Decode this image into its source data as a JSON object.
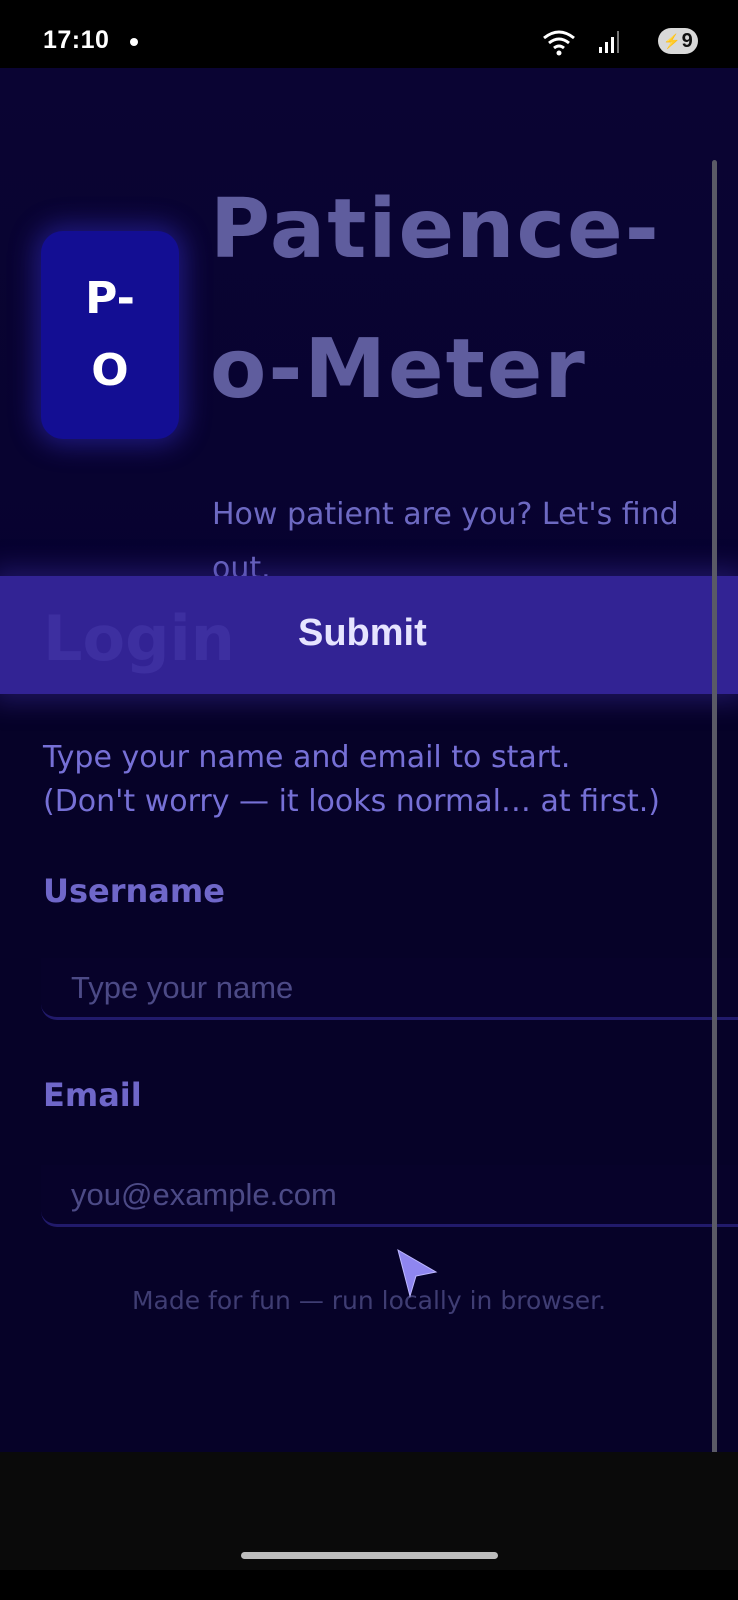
{
  "status_bar": {
    "time": "17:10",
    "battery_level": "9"
  },
  "app": {
    "logo_lines": [
      "P-",
      "O"
    ],
    "title_lines": [
      "Patience-",
      "o-Meter"
    ],
    "subtitle": "How patient are you? Let's find out.",
    "login_heading": "Login",
    "submit_label": "Submit",
    "intro_line1": "Type your name and email to start.",
    "intro_line2": "(Don't worry — it looks normal… at first.)",
    "username": {
      "label": "Username",
      "placeholder": "Type your name",
      "value": ""
    },
    "email": {
      "label": "Email",
      "placeholder": "you@example.com",
      "value": ""
    },
    "footer_note": "Made for fun — run locally in browser.",
    "colors": {
      "background": "#060228",
      "accent_band": "#322394",
      "logo_badge": "#130e93",
      "label": "#6f67c9",
      "title": "#5f5d9e"
    }
  }
}
